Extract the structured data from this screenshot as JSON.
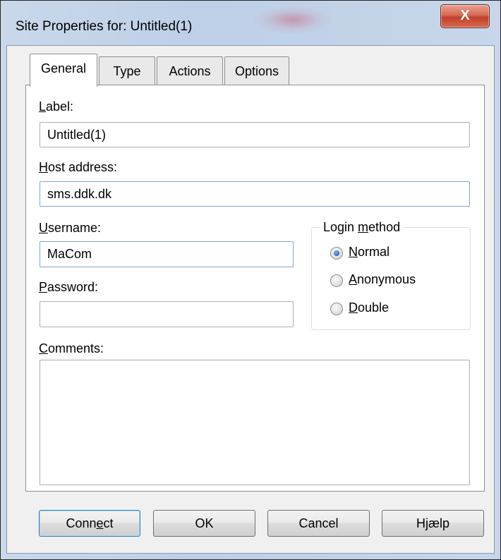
{
  "window": {
    "title": "Site Properties for: Untitled(1)",
    "close_glyph": "X"
  },
  "tabs": [
    {
      "label": "General",
      "active": true
    },
    {
      "label": "Type",
      "active": false
    },
    {
      "label": "Actions",
      "active": false
    },
    {
      "label": "Options",
      "active": false
    }
  ],
  "form": {
    "label": {
      "label_mnemonic": "L",
      "label_rest": "abel:",
      "value": "Untitled(1)"
    },
    "host": {
      "label_mnemonic": "H",
      "label_rest": "ost address:",
      "value": "sms.ddk.dk"
    },
    "username": {
      "label_mnemonic": "U",
      "label_rest": "sername:",
      "value": "MaCom"
    },
    "password": {
      "label_mnemonic": "P",
      "label_rest": "assword:",
      "value": ""
    },
    "comments": {
      "label_mnemonic": "C",
      "label_rest": "omments:",
      "value": ""
    }
  },
  "login_method": {
    "legend_pre": "Login ",
    "legend_mnemonic": "m",
    "legend_post": "ethod",
    "options": [
      {
        "mnemonic": "N",
        "rest": "ormal",
        "selected": true
      },
      {
        "mnemonic": "A",
        "rest": "nonymous",
        "selected": false
      },
      {
        "mnemonic": "D",
        "rest": "ouble",
        "selected": false
      }
    ]
  },
  "buttons": {
    "connect": {
      "pre": "Conn",
      "mnemonic": "e",
      "post": "ct"
    },
    "ok": "OK",
    "cancel": "Cancel",
    "help": "Hjælp"
  },
  "colors": {
    "close_button": "#c0402a",
    "title_bar": "#bdd0e7",
    "focus_border": "#7fa6d6"
  }
}
